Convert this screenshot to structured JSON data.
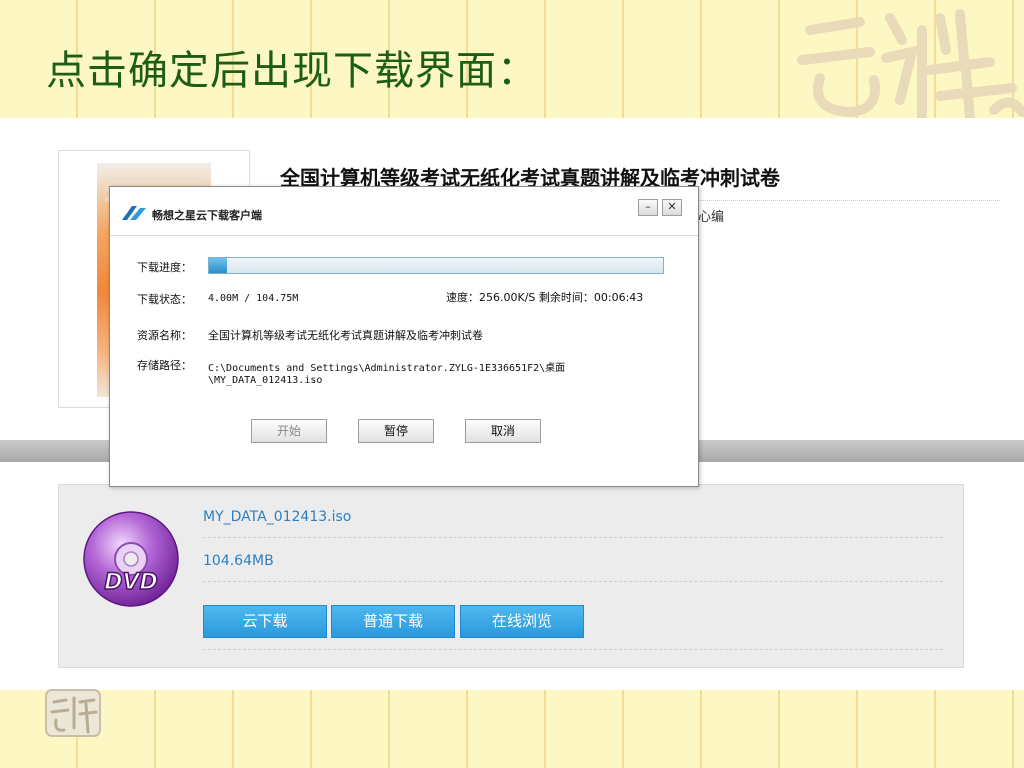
{
  "slide": {
    "title": "点击确定后出现下载界面："
  },
  "book": {
    "title": "全国计算机等级考试无纸化考试真题讲解及临考冲刺试卷",
    "meta_fragment": "心编"
  },
  "download_panel": {
    "filename": "MY_DATA_012413.iso",
    "size": "104.64MB",
    "disc_label": "DVD",
    "buttons": {
      "cloud": "云下载",
      "normal": "普通下载",
      "online": "在线浏览"
    }
  },
  "dialog": {
    "title": "畅想之星云下载客户端",
    "minimize_glyph": "–",
    "close_glyph": "✕",
    "progress_label": "下载进度：",
    "progress_fraction": 0.04,
    "status_label": "下载状态：",
    "status_value": "4.00M / 104.75M",
    "speed_text": "速度：256.00K/S 剩余时间：00:06:43",
    "resource_label": "资源名称：",
    "resource_value": "全国计算机等级考试无纸化考试真题讲解及临考冲刺试卷",
    "path_label": "存储路径：",
    "path_line1": "C:\\Documents  and  Settings\\Administrator.ZYLG-1E336651F2\\桌面",
    "path_line2": "\\MY_DATA_012413.iso",
    "buttons": {
      "start": "开始",
      "pause": "暂停",
      "cancel": "取消"
    }
  },
  "colors": {
    "slide_background": "#fdf7c3",
    "title_green": "#1d5e16",
    "link_blue": "#2e7fc1",
    "button_blue": "#2a98dc",
    "progress_blue": "#2a8dc6"
  },
  "icons": {
    "seal": "seal-stamp-icon",
    "disc": "dvd-disc-icon",
    "app_logo": "app-logo-icon"
  }
}
